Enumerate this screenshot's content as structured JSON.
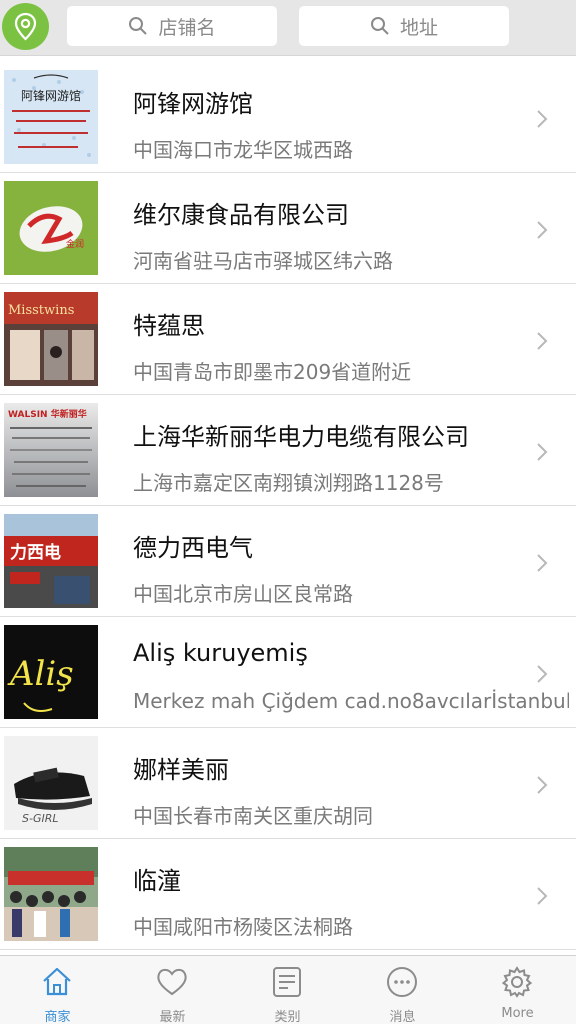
{
  "header": {
    "search_shop_placeholder": "店铺名",
    "search_address_placeholder": "地址"
  },
  "shops": [
    {
      "name": "阿锋网游馆",
      "address": "中国海口市龙华区城西路",
      "thumb_text": "阿锋网游馆"
    },
    {
      "name": "维尔康食品有限公司",
      "address": "河南省驻马店市驿城区纬六路",
      "thumb_text": "金润"
    },
    {
      "name": "特蕴思",
      "address": "中国青岛市即墨市209省道附近",
      "thumb_text": "Misstwins"
    },
    {
      "name": "上海华新丽华电力电缆有限公司",
      "address": "上海市嘉定区南翔镇浏翔路1128号",
      "thumb_text": "WALSIN 华新丽华"
    },
    {
      "name": "德力西电气",
      "address": "中国北京市房山区良常路",
      "thumb_text": "力西电"
    },
    {
      "name": "Aliş kuruyemiş",
      "address": "Merkez mah Çiğdem cad.no8avcılarİstanbul",
      "thumb_text": "Aliş"
    },
    {
      "name": "娜样美丽",
      "address": "中国长春市南关区重庆胡同",
      "thumb_text": "S-GIRL"
    },
    {
      "name": "临潼",
      "address": "中国咸阳市杨陵区法桐路",
      "thumb_text": ""
    }
  ],
  "tabs": [
    {
      "label": "商家",
      "icon": "home-icon",
      "active": true
    },
    {
      "label": "最新",
      "icon": "heart-icon",
      "active": false
    },
    {
      "label": "类别",
      "icon": "category-icon",
      "active": false
    },
    {
      "label": "消息",
      "icon": "message-icon",
      "active": false
    },
    {
      "label": "More",
      "icon": "gear-icon",
      "active": false
    }
  ],
  "colors": {
    "accent_green": "#7cc242",
    "active_tab": "#3a8fd6",
    "inactive_tab": "#8c8c8c"
  }
}
